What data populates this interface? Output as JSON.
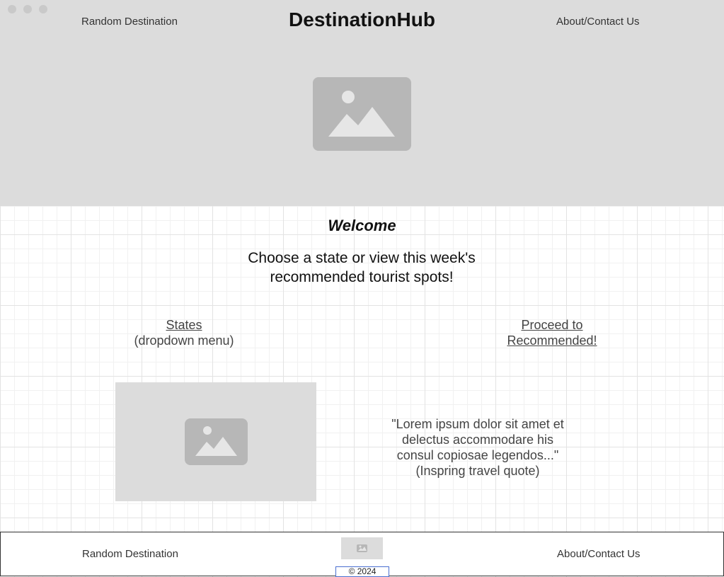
{
  "window": {
    "controls": [
      "close-dot",
      "minimize-dot",
      "maximize-dot"
    ]
  },
  "header": {
    "left_link": "Random Destination",
    "brand": "DestinationHub",
    "right_link": "About/Contact Us",
    "hero_image_icon": "image-placeholder-icon"
  },
  "main": {
    "welcome": "Welcome",
    "tagline_line1": "Choose a state or view this week's",
    "tagline_line2": "recommended tourist spots!",
    "states_link": "States",
    "states_note": "(dropdown menu)",
    "recommended_line1": "Proceed to",
    "recommended_line2": "Recommended!",
    "quote_line1": "\"Lorem ipsum dolor sit amet et",
    "quote_line2": "delectus accommodare his",
    "quote_line3": "consul copiosae legendos...\"",
    "quote_caption": "(Inspring travel quote)",
    "photo_icon": "image-placeholder-icon"
  },
  "footer": {
    "left_link": "Random Destination",
    "right_link": "About/Contact Us",
    "logo_icon": "image-placeholder-icon",
    "copyright": "© 2024"
  },
  "colors": {
    "hero_bg": "#dcdcdc",
    "placeholder_fill": "#b7b7b7",
    "text": "#333333"
  }
}
